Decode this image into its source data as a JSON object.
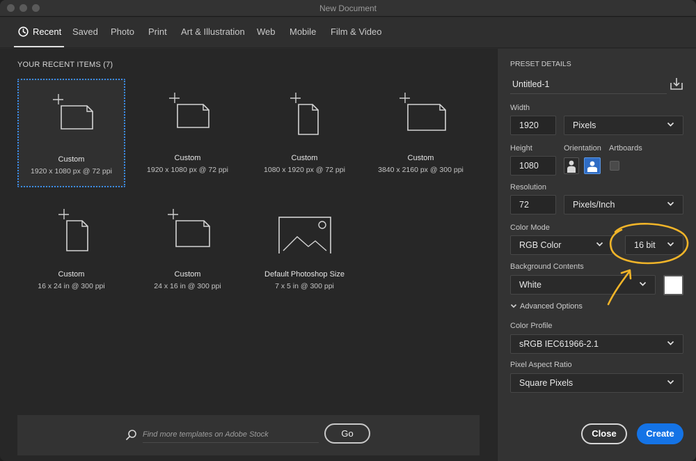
{
  "window": {
    "title": "New Document"
  },
  "tabs": [
    {
      "label": "Recent",
      "active": true
    },
    {
      "label": "Saved"
    },
    {
      "label": "Photo"
    },
    {
      "label": "Print"
    },
    {
      "label": "Art & Illustration"
    },
    {
      "label": "Web"
    },
    {
      "label": "Mobile"
    },
    {
      "label": "Film & Video"
    }
  ],
  "recent": {
    "heading": "YOUR RECENT ITEMS",
    "count": "(7)",
    "items": [
      {
        "name": "Custom",
        "size": "1920 x 1080 px @ 72 ppi",
        "icon": "landscape-document-icon",
        "selected": true
      },
      {
        "name": "Custom",
        "size": "1920 x 1080 px @ 72 ppi",
        "icon": "landscape-document-icon"
      },
      {
        "name": "Custom",
        "size": "1080 x 1920 px @ 72 ppi",
        "icon": "portrait-document-icon"
      },
      {
        "name": "Custom",
        "size": "3840 x 2160 px @ 300 ppi",
        "icon": "landscape-document-icon"
      },
      {
        "name": "Custom",
        "size": "16 x 24 in @ 300 ppi",
        "icon": "portrait-document-icon"
      },
      {
        "name": "Custom",
        "size": "24 x 16 in @ 300 ppi",
        "icon": "landscape-document-icon"
      },
      {
        "name": "Default Photoshop Size",
        "size": "7 x 5 in @ 300 ppi",
        "icon": "image-placeholder-icon"
      }
    ]
  },
  "search": {
    "placeholder": "Find more templates on Adobe Stock",
    "value": "",
    "go_label": "Go"
  },
  "preset": {
    "heading": "PRESET DETAILS",
    "name": "Untitled-1",
    "width_label": "Width",
    "width_value": "1920",
    "width_unit": "Pixels",
    "height_label": "Height",
    "height_value": "1080",
    "orientation_label": "Orientation",
    "orientation": "landscape",
    "artboards_label": "Artboards",
    "artboards_checked": false,
    "resolution_label": "Resolution",
    "resolution_value": "72",
    "resolution_unit": "Pixels/Inch",
    "color_mode_label": "Color Mode",
    "color_mode": "RGB Color",
    "bit_depth": "16 bit",
    "background_label": "Background Contents",
    "background": "White",
    "background_swatch": "#ffffff",
    "advanced_label": "Advanced Options",
    "color_profile_label": "Color Profile",
    "color_profile": "sRGB IEC61966-2.1",
    "pixel_aspect_label": "Pixel Aspect Ratio",
    "pixel_aspect": "Square Pixels"
  },
  "actions": {
    "close_label": "Close",
    "create_label": "Create"
  },
  "colors": {
    "accent": "#1473e6",
    "selection": "#3b8ef0",
    "annotation": "#f0b429"
  }
}
